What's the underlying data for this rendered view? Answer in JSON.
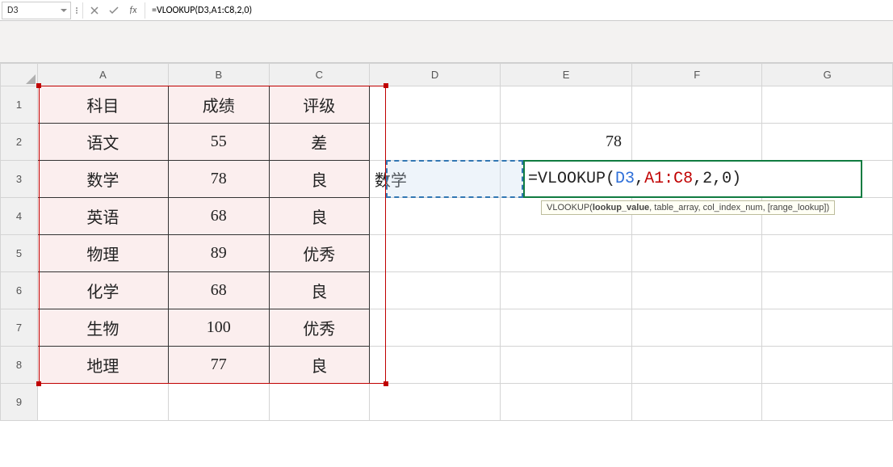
{
  "name_box": {
    "value": "D3"
  },
  "formula_bar": {
    "fx_label": "fx",
    "value": "=VLOOKUP(D3,A1:C8,2,0)"
  },
  "columns": [
    "A",
    "B",
    "C",
    "D",
    "E",
    "F",
    "G"
  ],
  "rows": [
    "1",
    "2",
    "3",
    "4",
    "5",
    "6",
    "7",
    "8",
    "9"
  ],
  "table": {
    "header": {
      "subject": "科目",
      "score": "成绩",
      "rating": "评级"
    },
    "data": [
      {
        "subject": "语文",
        "score": "55",
        "rating": "差"
      },
      {
        "subject": "数学",
        "score": "78",
        "rating": "良"
      },
      {
        "subject": "英语",
        "score": "68",
        "rating": "良"
      },
      {
        "subject": "物理",
        "score": "89",
        "rating": "优秀"
      },
      {
        "subject": "化学",
        "score": "68",
        "rating": "良"
      },
      {
        "subject": "生物",
        "score": "100",
        "rating": "优秀"
      },
      {
        "subject": "地理",
        "score": "77",
        "rating": "良"
      }
    ]
  },
  "d3_value": "数学",
  "e2_value": "78",
  "e3_formula": {
    "prefix": "=VLOOKUP(",
    "ref1": "D3",
    "sep1": ",",
    "ref2": "A1:C8",
    "tail": ",2,0)"
  },
  "tooltip": {
    "fn": "VLOOKUP(",
    "active": "lookup_value",
    "rest": ", table_array, col_index_num, [range_lookup])"
  }
}
